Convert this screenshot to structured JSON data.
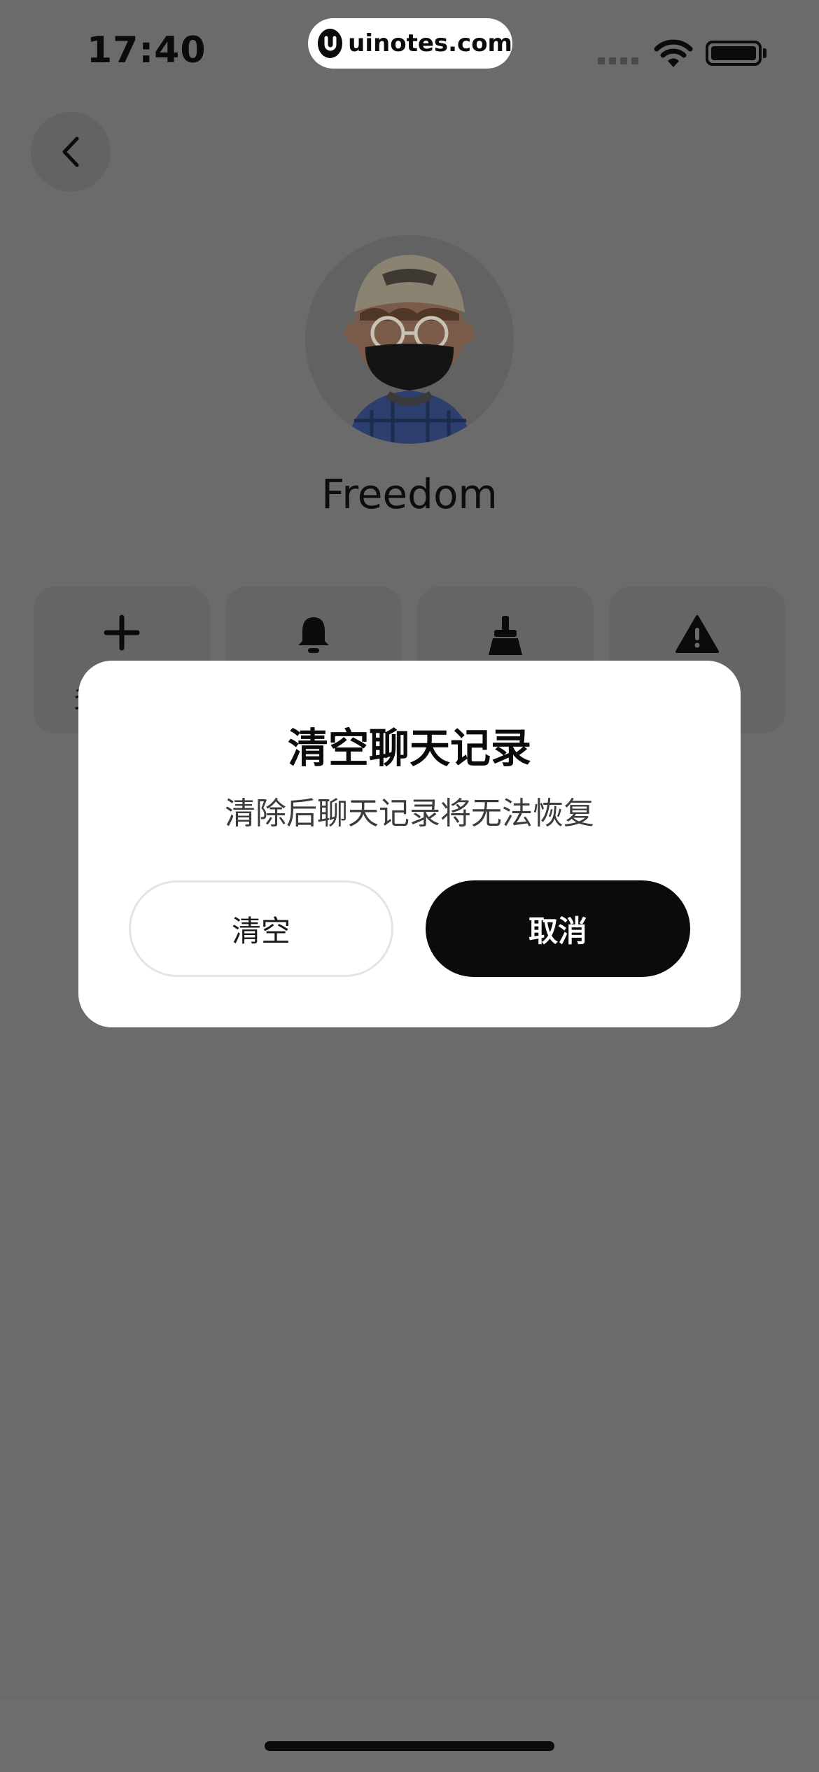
{
  "status_bar": {
    "time": "17:40",
    "watermark": "uinotes.com"
  },
  "profile": {
    "name": "Freedom"
  },
  "actions": [
    {
      "icon": "plus-icon",
      "label": "多"
    },
    {
      "icon": "bell-icon",
      "label": ""
    },
    {
      "icon": "broom-icon",
      "label": ""
    },
    {
      "icon": "warning-icon",
      "label": ""
    }
  ],
  "dialog": {
    "title": "清空聊天记录",
    "message": "清除后聊天记录将无法恢复",
    "clear_label": "清空",
    "cancel_label": "取消"
  },
  "colors": {
    "overlay": "#6b6b6b",
    "dialog_bg": "#ffffff",
    "primary_button": "#0b0b0b"
  }
}
